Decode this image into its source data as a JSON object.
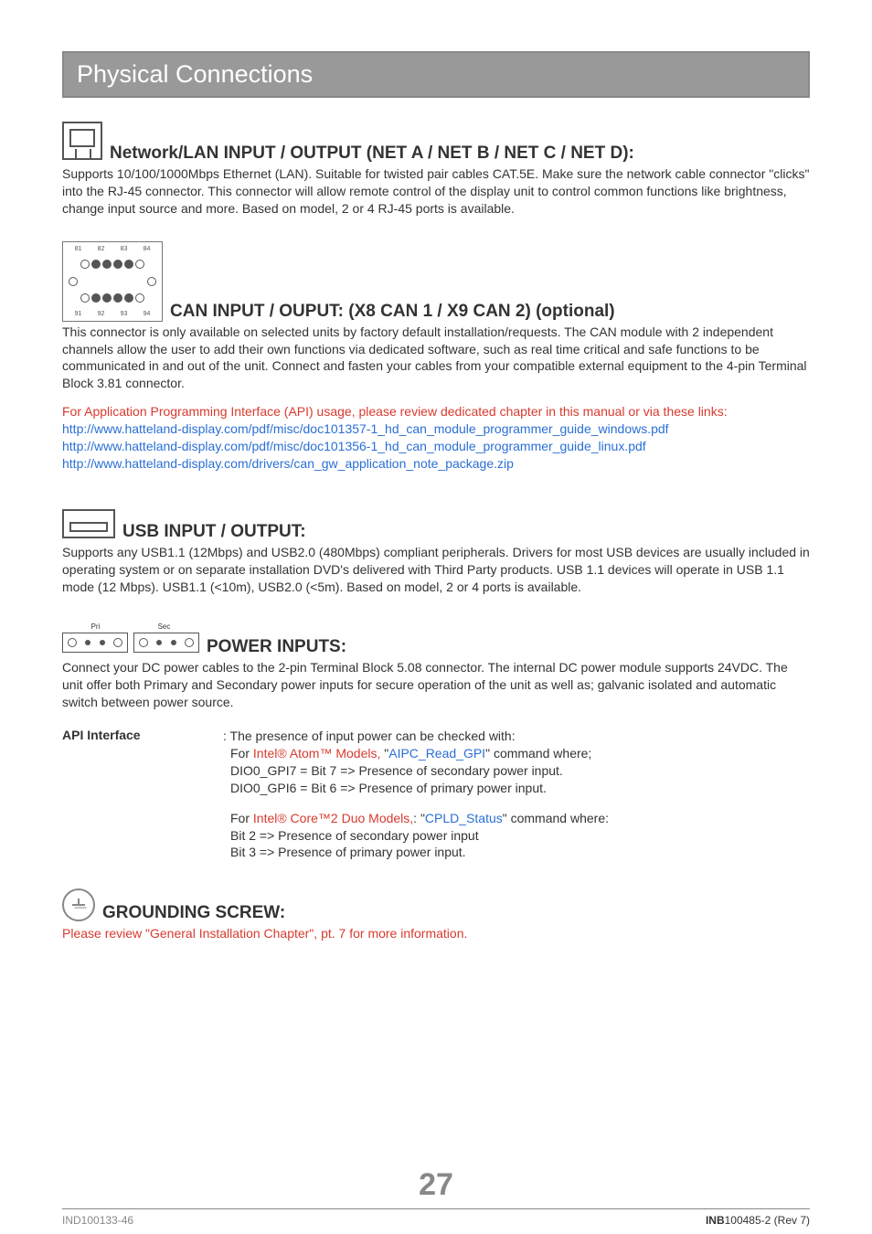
{
  "title": "Physical Connections",
  "network": {
    "heading": "Network/LAN INPUT / OUTPUT (NET A / NET B / NET C / NET D):",
    "text": "Supports 10/100/1000Mbps Ethernet (LAN). Suitable for twisted pair cables CAT.5E. Make sure the network cable connector \"clicks\" into the RJ-45 connector. This connector will allow remote control of the display unit to control common functions like brightness, change input source and more. Based on model, 2 or 4 RJ-45 ports is available."
  },
  "can": {
    "heading": "CAN INPUT / OUPUT: (X8 CAN 1 / X9 CAN 2) (optional)",
    "text": "This connector is only available on selected units by factory default installation/requests. The CAN module with 2 independent channels allow the user to add their own functions via dedicated software, such as real time critical and safe functions to be communicated in and out of the unit. Connect and fasten your cables from your compatible external equipment to the 4-pin Terminal Block 3.81 connector.",
    "note_red": "For Application Programming Interface (API) usage, please review dedicated chapter in this manual or via these links:",
    "link1": "http://www.hatteland-display.com/pdf/misc/doc101357-1_hd_can_module_programmer_guide_windows.pdf",
    "link2": "http://www.hatteland-display.com/pdf/misc/doc101356-1_hd_can_module_programmer_guide_linux.pdf",
    "link3": "http://www.hatteland-display.com/drivers/can_gw_application_note_package.zip",
    "labels_top": {
      "a": "81",
      "b": "82",
      "c": "83",
      "d": "84"
    },
    "labels_bottom": {
      "a": "91",
      "b": "92",
      "c": "93",
      "d": "94"
    }
  },
  "usb": {
    "heading": "USB INPUT / OUTPUT:",
    "text": "Supports any USB1.1 (12Mbps) and USB2.0 (480Mbps) compliant peripherals. Drivers for most USB devices are usually included in operating system or on separate installation DVD's delivered with Third Party products. USB 1.1 devices will operate in USB 1.1 mode (12 Mbps). USB1.1 (<10m), USB2.0 (<5m). Based on model, 2 or 4 ports is available."
  },
  "power": {
    "pri": "Pri",
    "sec": "Sec",
    "heading": "POWER INPUTS:",
    "text": "Connect your DC power cables to the 2-pin Terminal Block 5.08 connector. The internal DC power module supports 24VDC. The unit offer both Primary and Secondary power inputs for secure operation of the unit as well as; galvanic isolated and automatic switch between power source."
  },
  "api": {
    "label": "API Interface",
    "colon": ": ",
    "line1_pre": "The presence of input power can be checked with:",
    "line2_pre": "For ",
    "line2_red": "Intel® Atom™ Models,",
    "line2_mid": " \"",
    "line2_blue": "AIPC_Read_GPI",
    "line2_post": "\" command where;",
    "line3": "DIO0_GPI7  = Bit 7 => Presence of secondary power input.",
    "line4": "DIO0_GPI6  = Bit 6 => Presence of primary power input.",
    "b2_pre": "For ",
    "b2_red": "Intel® Core™2 Duo Models,",
    "b2_mid": ": \"",
    "b2_blue": "CPLD_Status",
    "b2_post": "\" command where:",
    "b2_l2": "Bit 2 => Presence of secondary power input",
    "b2_l3": "Bit 3 => Presence of primary power input."
  },
  "ground": {
    "heading": "GROUNDING SCREW:",
    "text": "Please review \"General Installation Chapter\", pt. 7 for more information."
  },
  "page_number": "27",
  "footer_left": "IND100133-46",
  "footer_right_bold": "INB",
  "footer_right_rest": "100485-2 (Rev 7)"
}
